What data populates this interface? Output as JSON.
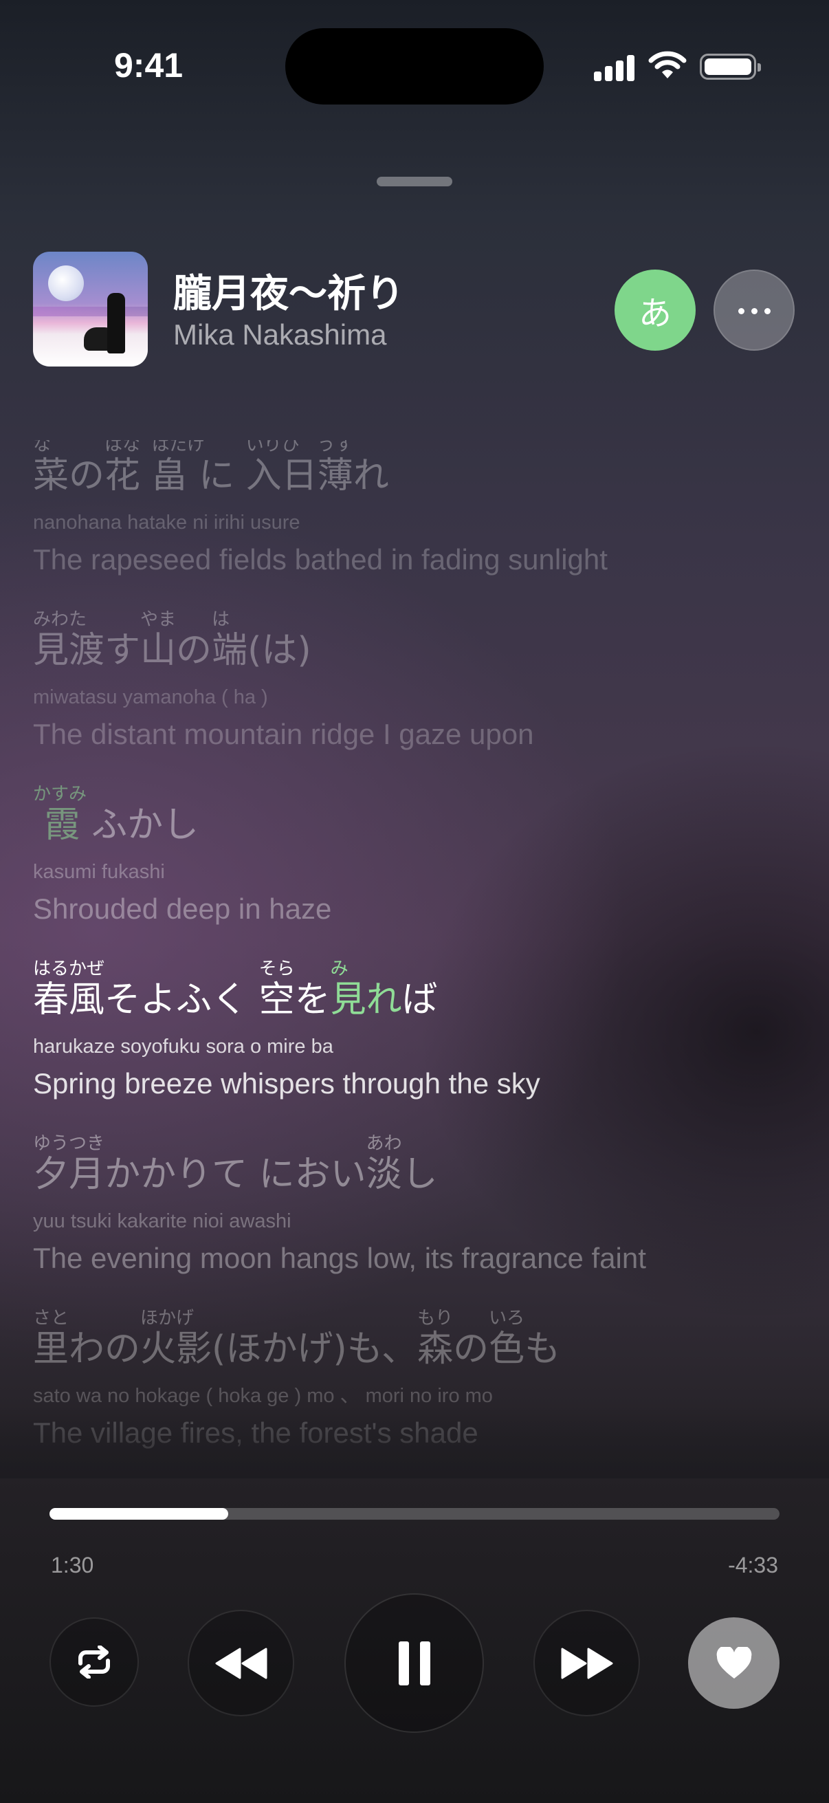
{
  "status_bar": {
    "time": "9:41"
  },
  "now_playing": {
    "title": "朧月夜〜祈り",
    "artist": "Mika Nakashima",
    "kana_button_label": "あ"
  },
  "lyrics": [
    {
      "state": "dim",
      "jp": [
        {
          "text": "菜",
          "ruby": "な"
        },
        {
          "text": "の"
        },
        {
          "text": "花",
          "ruby": "はな"
        },
        {
          "text": " "
        },
        {
          "text": "畠",
          "ruby": "はたけ"
        },
        {
          "text": " "
        },
        {
          "text": "に"
        },
        {
          "text": " "
        },
        {
          "text": "入日",
          "ruby": "いりひ"
        },
        {
          "text": "薄",
          "ruby": "うす"
        },
        {
          "text": "れ"
        }
      ],
      "romaji": "nanohana hatake ni irihi usure",
      "en": "The rapeseed fields bathed in fading sunlight"
    },
    {
      "state": "dim",
      "jp": [
        {
          "text": "見渡",
          "ruby": "みわた"
        },
        {
          "text": "す"
        },
        {
          "text": "山",
          "ruby": "やま"
        },
        {
          "text": "の"
        },
        {
          "text": "端",
          "ruby": "は"
        },
        {
          "text": "(は)"
        }
      ],
      "romaji": "miwatasu yamanoha ( ha )",
      "en": "The distant mountain ridge I gaze upon"
    },
    {
      "state": "mid",
      "jp": [
        {
          "text": " 霞",
          "ruby": "かすみ",
          "hl": "greenish"
        },
        {
          "text": " ふかし"
        }
      ],
      "romaji": "kasumi fukashi",
      "en": "Shrouded deep in haze"
    },
    {
      "state": "active",
      "jp": [
        {
          "text": "春風",
          "ruby": "はるかぜ"
        },
        {
          "text": "そよふく"
        },
        {
          "text": " "
        },
        {
          "text": "空",
          "ruby": "そら"
        },
        {
          "text": "を"
        },
        {
          "text": "見",
          "ruby": "み",
          "hl": "green"
        },
        {
          "text": "れ",
          "hl": "green"
        },
        {
          "text": "ば"
        }
      ],
      "romaji": "harukaze soyofuku sora o mire ba",
      "en": "Spring breeze whispers through the sky"
    },
    {
      "state": "mid",
      "jp": [
        {
          "text": "夕月",
          "ruby": "ゆうつき"
        },
        {
          "text": "かかりて"
        },
        {
          "text": " "
        },
        {
          "text": "におい"
        },
        {
          "text": "淡",
          "ruby": "あわ"
        },
        {
          "text": "し"
        }
      ],
      "romaji": "yuu tsuki kakarite nioi awashi",
      "en": "The evening moon hangs low, its fragrance faint"
    },
    {
      "state": "dim",
      "jp": [
        {
          "text": "里",
          "ruby": "さと"
        },
        {
          "text": "わの"
        },
        {
          "text": "火影",
          "ruby": "ほかげ"
        },
        {
          "text": "(ほかげ)も、"
        },
        {
          "text": "森",
          "ruby": "もり"
        },
        {
          "text": "の"
        },
        {
          "text": "色",
          "ruby": "いろ"
        },
        {
          "text": "も"
        }
      ],
      "romaji": "sato wa no hokage ( hoka ge ) mo 、 mori no iro mo",
      "en": "The village fires, the forest's shade"
    }
  ],
  "playback": {
    "elapsed": "1:30",
    "remaining": "-4:33",
    "progress_fraction": 0.245
  }
}
